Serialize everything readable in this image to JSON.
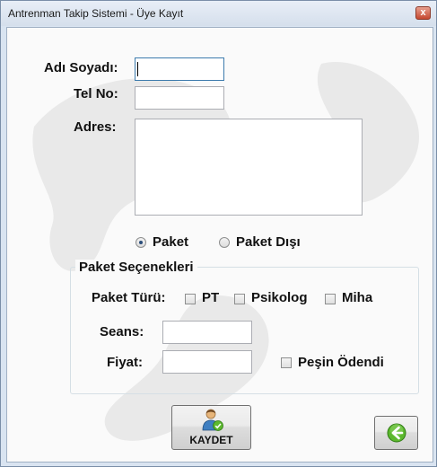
{
  "window": {
    "title": "Antrenman Takip Sistemi - Üye Kayıt",
    "close_glyph": "x"
  },
  "form": {
    "name_label": "Adı Soyadı:",
    "name_value": "",
    "phone_label": "Tel No:",
    "phone_value": "",
    "address_label": "Adres:",
    "address_value": "",
    "package_mode": {
      "options": [
        "Paket",
        "Paket Dışı"
      ],
      "selected": "Paket"
    },
    "package_options": {
      "group_title": "Paket Seçenekleri",
      "type_label": "Paket Türü:",
      "types": [
        {
          "label": "PT",
          "checked": false
        },
        {
          "label": "Psikolog",
          "checked": false
        },
        {
          "label": "Miha",
          "checked": false
        }
      ],
      "sessions_label": "Seans:",
      "sessions_value": "",
      "price_label": "Fiyat:",
      "price_value": "",
      "paid_label": "Peşin Ödendi",
      "paid_checked": false
    }
  },
  "actions": {
    "save_label": "KAYDET",
    "save_icon": "user-check-icon",
    "back_icon": "arrow-left-icon"
  },
  "colors": {
    "accent_green": "#5cb82e",
    "window_border": "#7a8ea8"
  }
}
